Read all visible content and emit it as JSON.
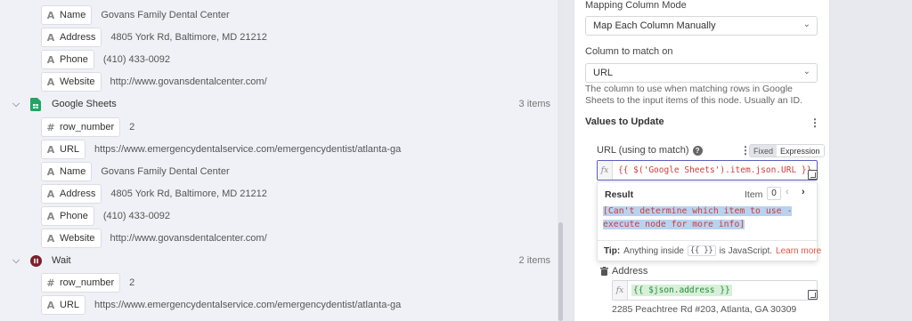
{
  "left_panel": {
    "rows": [
      {
        "kind": "field",
        "type": "A",
        "name": "Name",
        "value": "Govans Family Dental Center"
      },
      {
        "kind": "field",
        "type": "A",
        "name": "Address",
        "value": "4805 York Rd, Baltimore, MD 21212"
      },
      {
        "kind": "field",
        "type": "A",
        "name": "Phone",
        "value": "(410) 433-0092"
      },
      {
        "kind": "field",
        "type": "A",
        "name": "Website",
        "value": "http://www.govansdentalcenter.com/"
      },
      {
        "kind": "node",
        "icon": "google-sheets-icon",
        "name": "Google Sheets",
        "count": "3 items"
      },
      {
        "kind": "field",
        "type": "#",
        "name": "row_number",
        "value": "2"
      },
      {
        "kind": "field",
        "type": "A",
        "name": "URL",
        "value": "https://www.emergencydentalservice.com/emergencydentist/atlanta-ga"
      },
      {
        "kind": "field",
        "type": "A",
        "name": "Name",
        "value": "Govans Family Dental Center"
      },
      {
        "kind": "field",
        "type": "A",
        "name": "Address",
        "value": "4805 York Rd, Baltimore, MD 21212"
      },
      {
        "kind": "field",
        "type": "A",
        "name": "Phone",
        "value": "(410) 433-0092"
      },
      {
        "kind": "field",
        "type": "A",
        "name": "Website",
        "value": "http://www.govansdentalcenter.com/"
      },
      {
        "kind": "node",
        "icon": "wait-icon",
        "name": "Wait",
        "count": "2 items"
      },
      {
        "kind": "field",
        "type": "#",
        "name": "row_number",
        "value": "2"
      },
      {
        "kind": "field",
        "type": "A",
        "name": "URL",
        "value": "https://www.emergencydentalservice.com/emergencydentist/atlanta-ga"
      }
    ]
  },
  "right_panel": {
    "mapping_mode_label": "Mapping Column Mode",
    "mapping_mode_value": "Map Each Column Manually",
    "column_match_label": "Column to match on",
    "column_match_value": "URL",
    "column_match_hint": "The column to use when matching rows in Google Sheets to the input items of this node. Usually an ID.",
    "values_title": "Values to Update",
    "url_field": {
      "label": "URL (using to match)",
      "help": "?",
      "toggle_fixed": "Fixed",
      "toggle_expression": "Expression",
      "expression": "{{ $('Google Sheets').item.json.URL }}",
      "fx": "fx"
    },
    "result": {
      "title": "Result",
      "item_label": "Item",
      "item_index": "0",
      "text": "[Can't determine which item to use - execute node for more info]",
      "tip_label": "Tip:",
      "tip_text_1": "Anything inside",
      "tip_code": "{{ }}",
      "tip_text_2": "is JavaScript.",
      "tip_link": "Learn more"
    },
    "address_field": {
      "label": "Address",
      "expression": "{{ $json.address }}",
      "fx": "fx",
      "result": "2285 Peachtree Rd #203, Atlanta, GA 30309"
    }
  },
  "colors": {
    "accent": "#5a5fbd",
    "expression_red": "#d03a3a",
    "expression_green": "#2a8a3a",
    "link": "#e5553f",
    "sheets_green": "#21a464",
    "wait_maroon": "#7b1f2c"
  }
}
